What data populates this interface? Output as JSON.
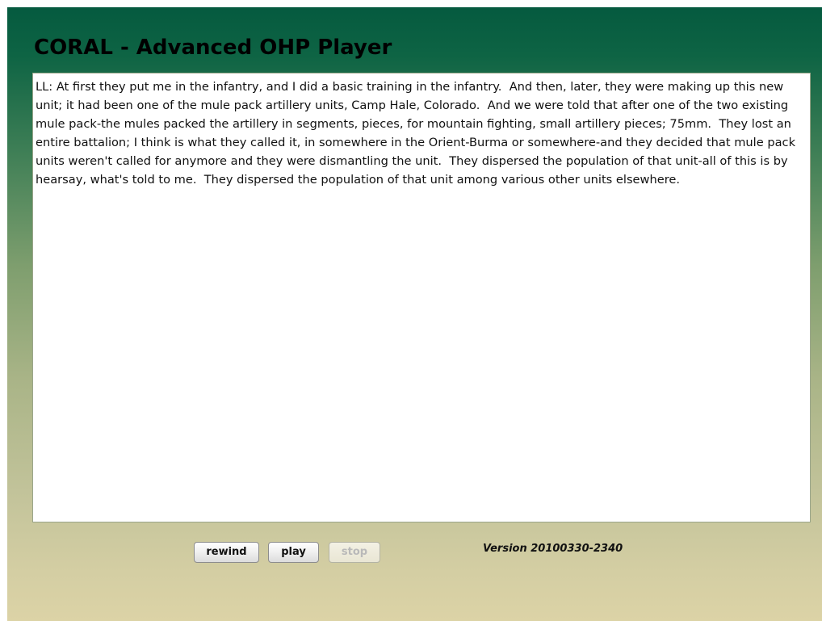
{
  "app": {
    "title": "CORAL - Advanced OHP Player"
  },
  "transcript": {
    "text": "LL: At first they put me in the infantry, and I did a basic training in the infantry.  And then, later, they were making up this new unit; it had been one of the mule pack artillery units, Camp Hale, Colorado.  And we were told that after one of the two existing mule pack-the mules packed the artillery in segments, pieces, for mountain fighting, small artillery pieces; 75mm.  They lost an entire battalion; I think is what they called it, in somewhere in the Orient-Burma or somewhere-and they decided that mule pack units weren't called for anymore and they were dismantling the unit.  They dispersed the population of that unit-all of this is by hearsay, what's told to me.  They dispersed the population of that unit among various other units elsewhere."
  },
  "controls": {
    "rewind_label": "rewind",
    "play_label": "play",
    "stop_label": "stop",
    "stop_enabled": false
  },
  "footer": {
    "version": "Version 20100330-2340"
  },
  "colors": {
    "header_green": "#055a3f",
    "bottom_tan": "#dcd3a6"
  }
}
